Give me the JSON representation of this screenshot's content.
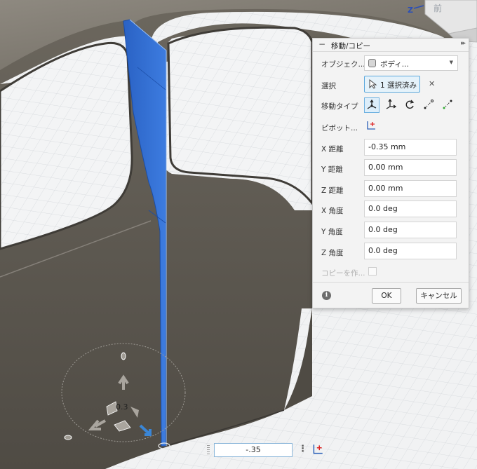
{
  "dialog": {
    "title": "移動/コピー",
    "object_label": "オブジェク...",
    "object_value": "ボディ...",
    "select_label": "選択",
    "select_button": "1 選択済み",
    "move_type_label": "移動タイプ",
    "pivot_label": "ピボット...",
    "fields": [
      {
        "label": "X 距離",
        "value": "-0.35 mm"
      },
      {
        "label": "Y 距離",
        "value": "0.00 mm"
      },
      {
        "label": "Z 距離",
        "value": "0.00 mm"
      },
      {
        "label": "X 角度",
        "value": "0.0 deg"
      },
      {
        "label": "Y 角度",
        "value": "0.0 deg"
      },
      {
        "label": "Z 角度",
        "value": "0.0 deg"
      }
    ],
    "copy_label": "コピーを作...",
    "ok": "OK",
    "cancel": "キャンセル"
  },
  "minitoolbar": {
    "value": "-.35"
  },
  "gizmo": {
    "label": "0.3"
  },
  "viewcube": {
    "z": "Z",
    "face": "前"
  },
  "colors": {
    "accent": "#2f6dd0",
    "body": "#6f6a60"
  }
}
